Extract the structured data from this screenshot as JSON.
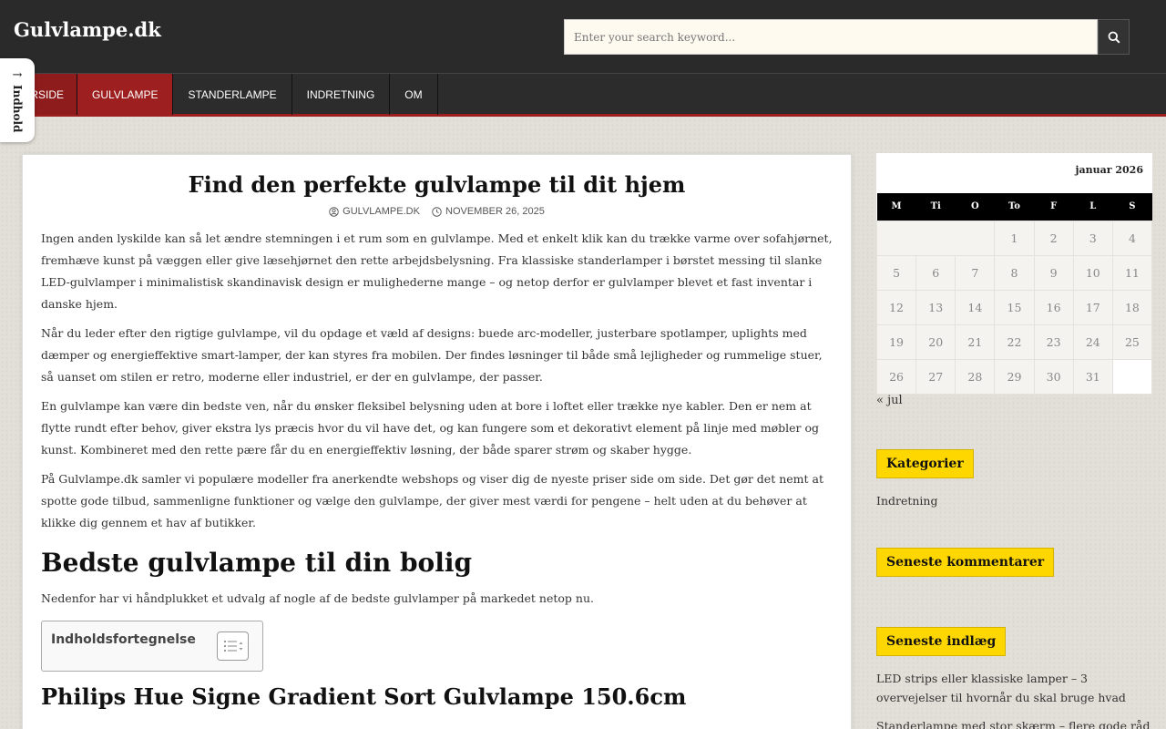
{
  "header": {
    "site_title": "Gulvlampe.dk",
    "search_placeholder": "Enter your search keyword..."
  },
  "nav": {
    "items": [
      {
        "label": "ORSIDE"
      },
      {
        "label": "GULVLAMPE"
      },
      {
        "label": "STANDERLAMPE"
      },
      {
        "label": "INDRETNING"
      },
      {
        "label": "OM"
      }
    ]
  },
  "side_tab": {
    "arrow": "→",
    "label": "Indhold"
  },
  "article": {
    "title": "Find den perfekte gulvlampe til dit hjem",
    "author": "GULVLAMPE.DK",
    "date": "NOVEMBER 26, 2025",
    "paragraphs": [
      "Ingen anden lyskilde kan så let ændre stemningen i et rum som en gulvlampe. Med et enkelt klik kan du trække varme over sofahjørnet, fremhæve kunst på væggen eller give læsehjørnet den rette arbejdsbelysning. Fra klassiske standerlamper i børstet messing til slanke LED-gulvlamper i minimalistisk skandinavisk design er mulighederne mange – og netop derfor er gulvlamper blevet et fast inventar i danske hjem.",
      "Når du leder efter den rigtige gulvlampe, vil du opdage et væld af designs: buede arc-modeller, justerbare spotlamper, uplights med dæmper og energieffektive smart-lamper, der kan styres fra mobilen. Der findes løsninger til både små lejligheder og rummelige stuer, så uanset om stilen er retro, moderne eller industriel, er der en gulvlampe, der passer.",
      "En gulvlampe kan være din bedste ven, når du ønsker fleksibel belysning uden at bore i loftet eller trække nye kabler. Den er nem at flytte rundt efter behov, giver ekstra lys præcis hvor du vil have det, og kan fungere som et dekorativt element på linje med møbler og kunst. Kombineret med den rette pære får du en energieffektiv løsning, der både sparer strøm og skaber hygge.",
      "På Gulvlampe.dk samler vi populære modeller fra anerkendte webshops og viser dig de nyeste priser side om side. Det gør det nemt at spotte gode tilbud, sammenligne funktioner og vælge den gulvlampe, der giver mest værdi for pengene – helt uden at du behøver at klikke dig gennem et hav af butikker."
    ],
    "h2": "Bedste gulvlampe til din bolig",
    "intro": "Nedenfor har vi håndplukket et udvalg af nogle af de bedste gulvlamper på markedet netop nu.",
    "toc_title": "Indholdsfortegnelse",
    "h3": "Philips Hue Signe Gradient Sort Gulvlampe 150.6cm"
  },
  "calendar": {
    "caption": "januar 2026",
    "weekdays": [
      "M",
      "Ti",
      "O",
      "To",
      "F",
      "L",
      "S"
    ],
    "weeks": [
      [
        "",
        "",
        "",
        "1",
        "2",
        "3",
        "4"
      ],
      [
        "5",
        "6",
        "7",
        "8",
        "9",
        "10",
        "11"
      ],
      [
        "12",
        "13",
        "14",
        "15",
        "16",
        "17",
        "18"
      ],
      [
        "19",
        "20",
        "21",
        "22",
        "23",
        "24",
        "25"
      ],
      [
        "26",
        "27",
        "28",
        "29",
        "30",
        "31",
        ""
      ]
    ],
    "prev": "« jul"
  },
  "sidebar": {
    "categories_title": "Kategorier",
    "categories": [
      "Indretning"
    ],
    "comments_title": "Seneste kommentarer",
    "posts_title": "Seneste indlæg",
    "posts": [
      "LED strips eller klassiske lamper – 3 overvejelser til hvornår du skal bruge hvad",
      "Standerlampe med stor skærm – flere gode råd"
    ]
  },
  "colors": {
    "header_bg": "#2a2a2a",
    "nav_active": "#9d1f1f",
    "widget_title_bg": "#ffd700"
  }
}
